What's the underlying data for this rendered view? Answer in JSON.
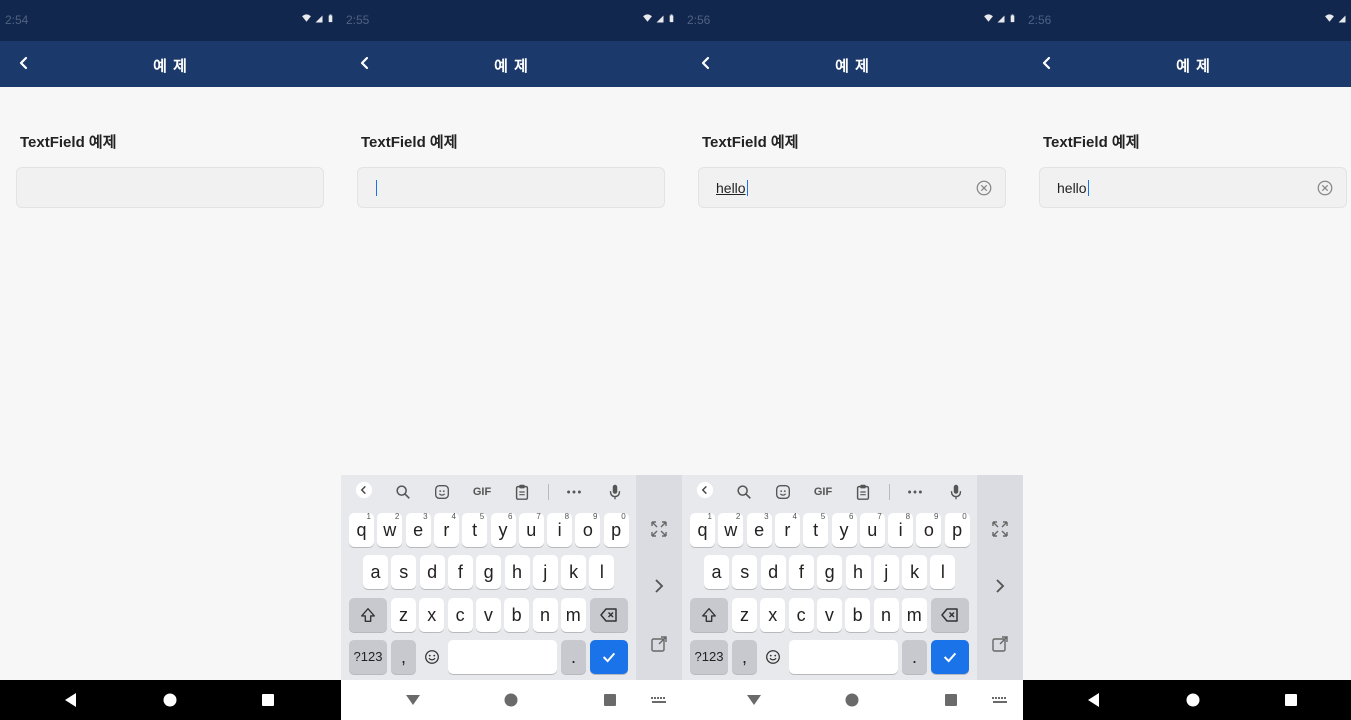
{
  "panels": [
    {
      "time": "2:54",
      "title": "예 제",
      "label": "TextField 예제",
      "value": "",
      "focused": false,
      "clear": false,
      "keyboard": false,
      "nav_light": false
    },
    {
      "time": "2:55",
      "title": "예 제",
      "label": "TextField 예제",
      "value": "",
      "focused": true,
      "clear": false,
      "keyboard": true,
      "nav_light": true
    },
    {
      "time": "2:56",
      "title": "예 제",
      "label": "TextField 예제",
      "value": "hello",
      "focused": true,
      "clear": true,
      "keyboard": true,
      "nav_light": true
    },
    {
      "time": "2:56",
      "title": "예 제",
      "label": "TextField 예제",
      "value": "hello",
      "focused": true,
      "clear": true,
      "keyboard": false,
      "nav_light": false
    }
  ],
  "keyboard": {
    "row1": [
      "q",
      "w",
      "e",
      "r",
      "t",
      "y",
      "u",
      "i",
      "o",
      "p"
    ],
    "row1_nums": [
      "1",
      "2",
      "3",
      "4",
      "5",
      "6",
      "7",
      "8",
      "9",
      "0"
    ],
    "row2": [
      "a",
      "s",
      "d",
      "f",
      "g",
      "h",
      "j",
      "k",
      "l"
    ],
    "row3": [
      "z",
      "x",
      "c",
      "v",
      "b",
      "n",
      "m"
    ],
    "symbols_label": "?123",
    "comma": ",",
    "period": ".",
    "gif_label": "GIF",
    "toolbar_icons": [
      "chevron-left-icon",
      "search-icon",
      "sticker-icon",
      "gif-icon",
      "clipboard-icon",
      "more-icon",
      "mic-icon"
    ],
    "side_icons": [
      "expand-icon",
      "chevron-right-icon",
      "float-icon"
    ]
  },
  "colors": {
    "status_bar": "#12274d",
    "app_bar": "#1b3a6b",
    "accent": "#1a73e8"
  }
}
